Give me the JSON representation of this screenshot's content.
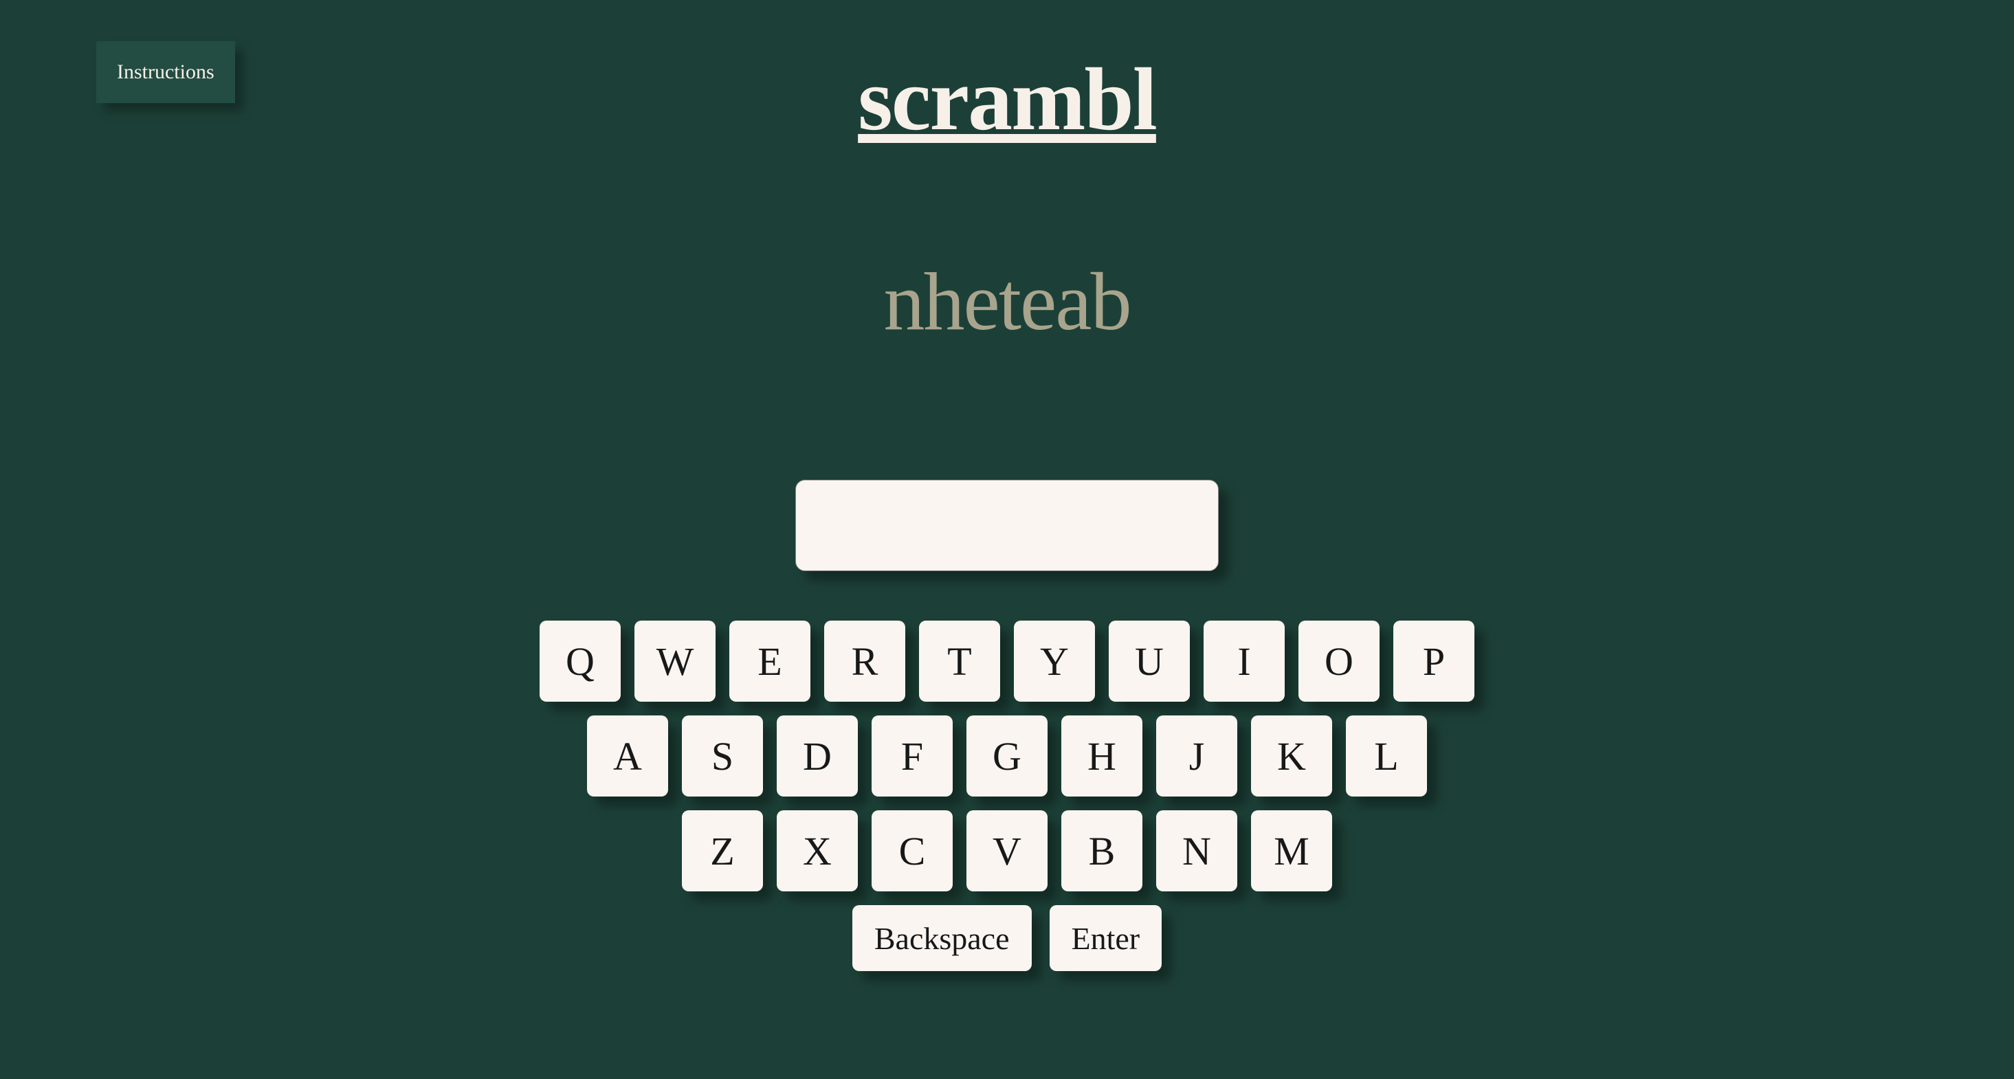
{
  "buttons": {
    "instructions": "Instructions"
  },
  "title": "scrambl",
  "scrambled_word": "nheteab",
  "guess_input": {
    "value": "",
    "placeholder": ""
  },
  "keyboard": {
    "row1": [
      "Q",
      "W",
      "E",
      "R",
      "T",
      "Y",
      "U",
      "I",
      "O",
      "P"
    ],
    "row2": [
      "A",
      "S",
      "D",
      "F",
      "G",
      "H",
      "J",
      "K",
      "L"
    ],
    "row3": [
      "Z",
      "X",
      "C",
      "V",
      "B",
      "N",
      "M"
    ],
    "backspace": "Backspace",
    "enter": "Enter"
  }
}
